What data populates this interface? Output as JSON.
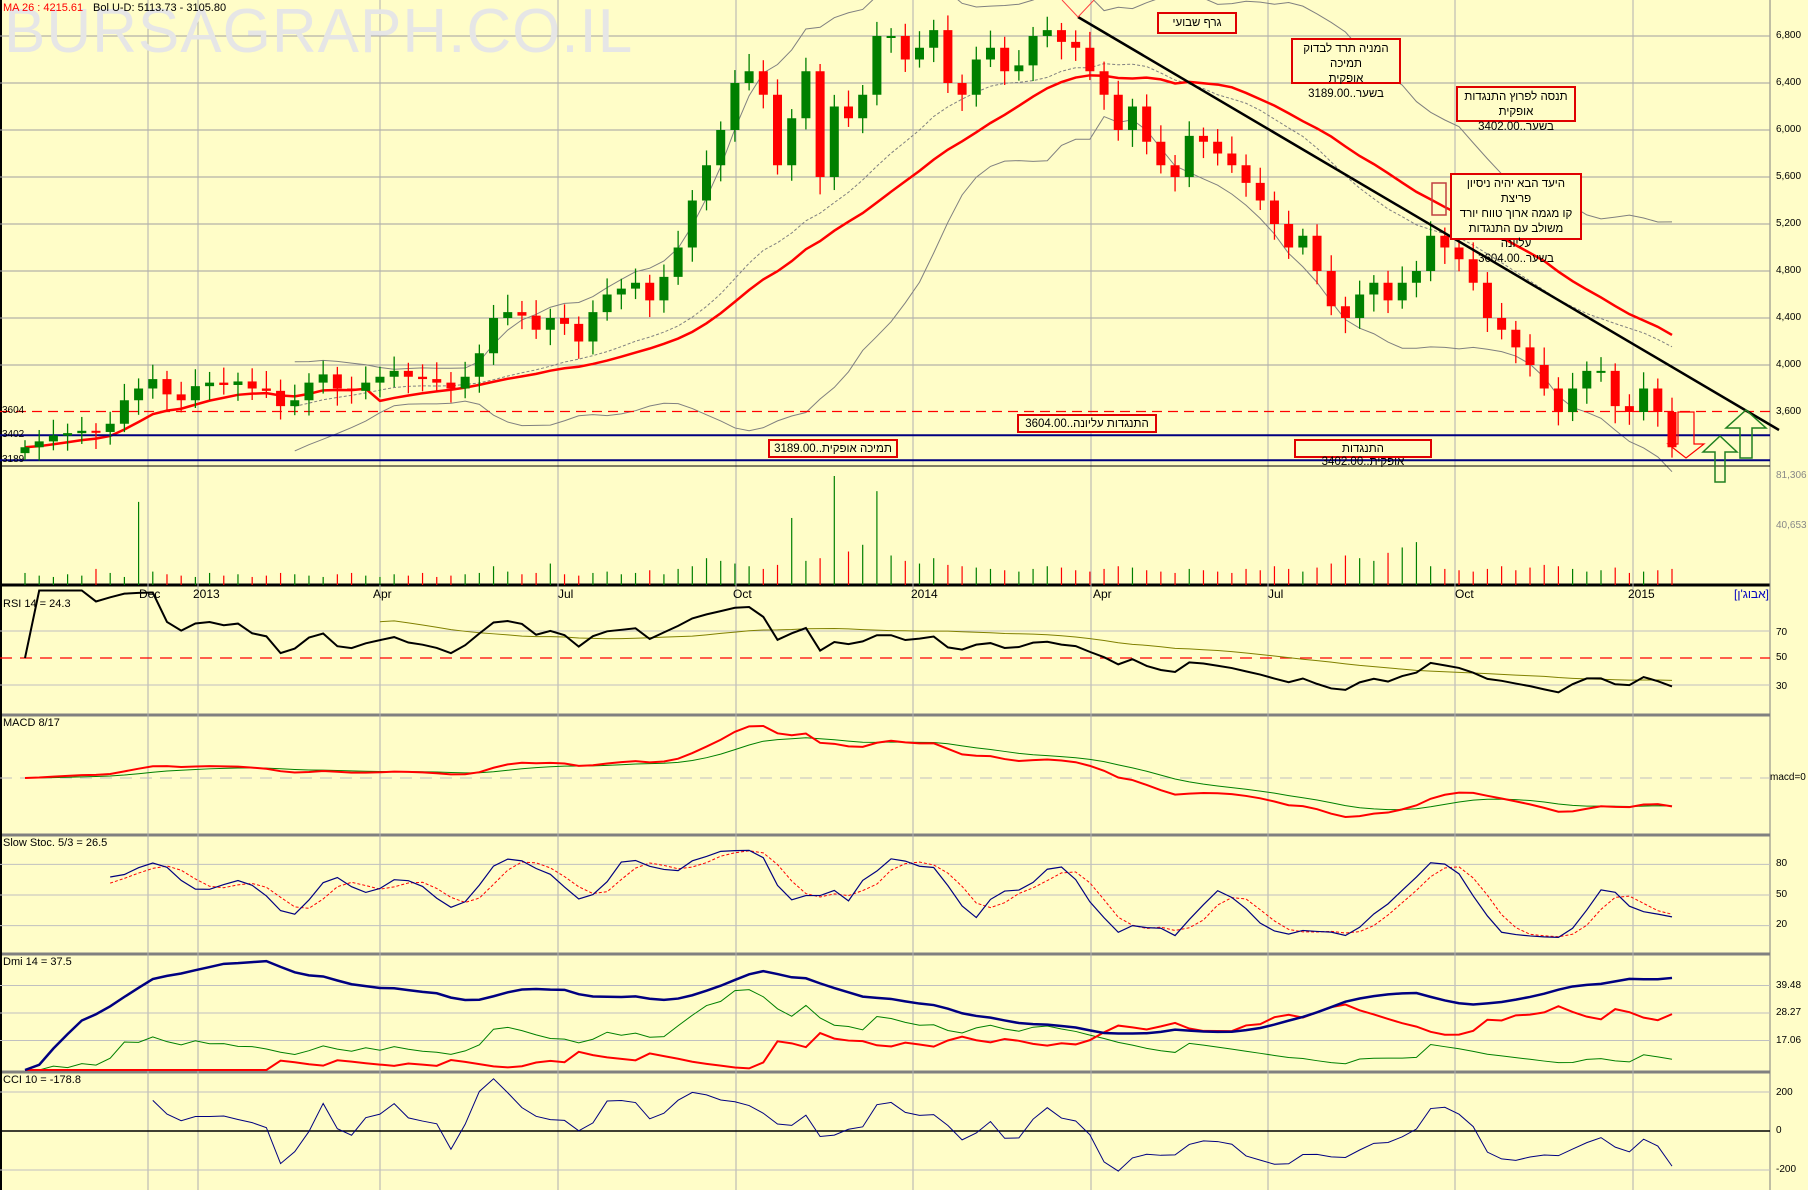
{
  "header": {
    "ma_label": "MA 26 : 4215.61",
    "bol_label": "Bol U-D: 5113.73 - 3105.80",
    "watermark": "BURSAGRAPH.CO.IL"
  },
  "notes": {
    "weekly": "גרף שבועי",
    "support_line1": "המניה תרד לבדוק תמיכה",
    "support_line2": "אופקית בשער..3189.00",
    "break_line1": "תנסה לפרוץ התנגדות אופקית",
    "break_line2": "בשער..3402.00",
    "target_line1": "היעד הבא יהיה ניסיון פריצת",
    "target_line2": "קו מגמה ארוך טווח יורד",
    "target_line3": "משולב עם התנגדות עליונה",
    "target_line4": "בשער..3604.00",
    "upper_res": "התנגדות עליונה..3604.00",
    "horiz_support": "תמיכה אופקית..3189.00",
    "horiz_res": "התנגדות אופקית..3402.00"
  },
  "left_levels": [
    "3604",
    "3402",
    "3189"
  ],
  "price_axis": [
    "6,800",
    "6,400",
    "6,000",
    "5,600",
    "5,200",
    "4,800",
    "4,400",
    "4,000",
    "3,600"
  ],
  "volume_axis": [
    "81,306",
    "40,653"
  ],
  "dates": [
    "Dec",
    "2013",
    "Apr",
    "Jul",
    "Oct",
    "2014",
    "Apr",
    "Jul",
    "Oct",
    "2015"
  ],
  "symbol_label": "[אבוג'ן]",
  "panels": {
    "rsi": {
      "label": "RSI 14 = 24.3",
      "ticks": [
        "70",
        "50",
        "30"
      ]
    },
    "macd": {
      "label": "MACD 8/17",
      "ticks": [
        "macd=0"
      ]
    },
    "stoch": {
      "label": "Slow Stoc. 5/3 = 26.5",
      "ticks": [
        "80",
        "50",
        "20"
      ]
    },
    "dmi": {
      "label": "Dmi 14 = 37.5",
      "ticks": [
        "39.48",
        "28.27",
        "17.06"
      ]
    },
    "cci": {
      "label": "CCI 10 = -178.8",
      "ticks": [
        "200",
        "0",
        "-200"
      ]
    }
  },
  "colors": {
    "up": "#008000",
    "down": "#ff0000",
    "ma": "#ff0000",
    "level": "#000080",
    "bg": "#fffdc8"
  },
  "chart_data": {
    "type": "candlestick",
    "title": "Weekly chart",
    "levels": {
      "upper_resistance": 3604,
      "horizontal_resistance": 3402,
      "horizontal_support": 3189
    },
    "ylim": [
      3100,
      6950
    ],
    "volume_max": 81306,
    "close": [
      3300,
      3350,
      3400,
      3420,
      3440,
      3430,
      3500,
      3700,
      3800,
      3880,
      3750,
      3700,
      3820,
      3850,
      3830,
      3860,
      3800,
      3780,
      3650,
      3700,
      3850,
      3920,
      3800,
      3780,
      3850,
      3900,
      3950,
      3900,
      3880,
      3850,
      3800,
      3900,
      4100,
      4400,
      4450,
      4420,
      4300,
      4400,
      4350,
      4200,
      4450,
      4600,
      4650,
      4700,
      4550,
      4750,
      5000,
      5400,
      5700,
      6000,
      6400,
      6500,
      6300,
      5700,
      6100,
      6500,
      5600,
      6200,
      6100,
      6300,
      6800,
      6800,
      6600,
      6700,
      6850,
      6400,
      6300,
      6600,
      6700,
      6500,
      6550,
      6800,
      6850,
      6750,
      6700,
      6500,
      6300,
      6000,
      6200,
      5900,
      5700,
      5600,
      5950,
      5900,
      5800,
      5700,
      5550,
      5400,
      5200,
      5000,
      5100,
      4800,
      4500,
      4400,
      4600,
      4700,
      4550,
      4700,
      4800,
      5100,
      5000,
      4900,
      4700,
      4400,
      4300,
      4150,
      4000,
      3800,
      3600,
      3800,
      3950,
      3950,
      3650,
      3600,
      3800,
      3600,
      3300
    ],
    "volume": [
      9000,
      7000,
      6000,
      8000,
      7000,
      12000,
      9000,
      6000,
      62000,
      10000,
      8000,
      7000,
      6000,
      9000,
      7000,
      8000,
      6000,
      7000,
      9000,
      8000,
      7000,
      6000,
      8000,
      9000,
      7000,
      6000,
      8000,
      7000,
      9000,
      6000,
      7000,
      8000,
      9000,
      14000,
      10000,
      8000,
      9000,
      16000,
      8000,
      7000,
      9000,
      10000,
      8000,
      9000,
      11000,
      8000,
      12000,
      14000,
      20000,
      18000,
      16000,
      14000,
      12000,
      15000,
      50000,
      18000,
      20000,
      81306,
      25000,
      30000,
      70000,
      22000,
      18000,
      16000,
      20000,
      15000,
      14000,
      13000,
      12000,
      11000,
      10000,
      12000,
      14000,
      13000,
      11000,
      10000,
      12000,
      14000,
      13000,
      11000,
      10000,
      9000,
      12000,
      11000,
      10000,
      9000,
      12000,
      11000,
      14000,
      12000,
      10000,
      13000,
      16000,
      22000,
      20000,
      18000,
      24000,
      28000,
      32000,
      14000,
      12000,
      11000,
      10000,
      12000,
      14000,
      11000,
      13000,
      15000,
      14000,
      12000,
      10000,
      11000,
      13000,
      9000,
      10000,
      11000,
      12000
    ]
  }
}
